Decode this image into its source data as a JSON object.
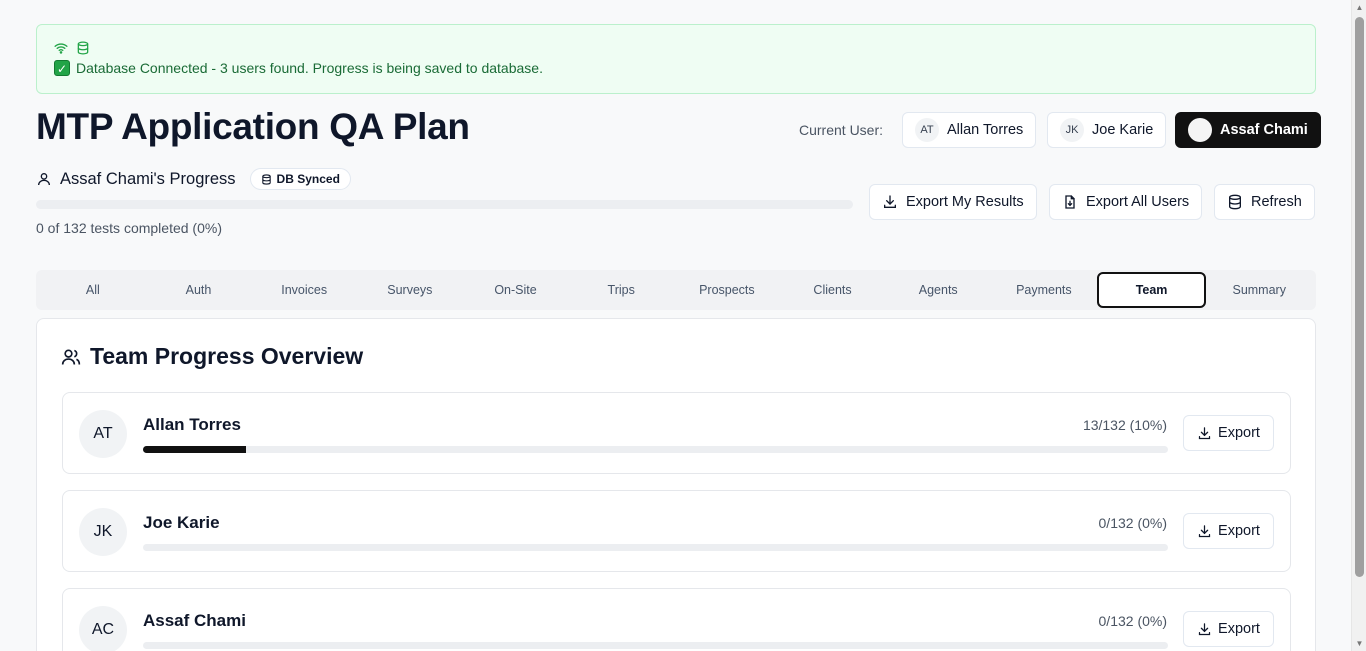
{
  "banner": {
    "message": "Database Connected - 3 users found. Progress is being saved to database.",
    "icons": [
      "wifi-icon",
      "database-icon",
      "checkmark-icon"
    ],
    "bg_color": "#effdf3",
    "text_color": "#1a6b36"
  },
  "header": {
    "title": "MTP Application QA Plan",
    "current_user_label": "Current User:",
    "users": [
      {
        "initials": "AT",
        "name": "Allan Torres",
        "active": false
      },
      {
        "initials": "JK",
        "name": "Joe Karie",
        "active": false
      },
      {
        "initials": "",
        "name": "Assaf Chami",
        "active": true
      }
    ]
  },
  "progress": {
    "label": "Assaf Chami's Progress",
    "badge": "DB Synced",
    "summary": "0 of 132 tests completed (0%)",
    "fraction": 0
  },
  "actions": {
    "export_mine": "Export My Results",
    "export_all": "Export All Users",
    "refresh": "Refresh"
  },
  "tabs": [
    {
      "label": "All",
      "active": false
    },
    {
      "label": "Auth",
      "active": false
    },
    {
      "label": "Invoices",
      "active": false
    },
    {
      "label": "Surveys",
      "active": false
    },
    {
      "label": "On-Site",
      "active": false
    },
    {
      "label": "Trips",
      "active": false
    },
    {
      "label": "Prospects",
      "active": false
    },
    {
      "label": "Clients",
      "active": false
    },
    {
      "label": "Agents",
      "active": false
    },
    {
      "label": "Payments",
      "active": false
    },
    {
      "label": "Team",
      "active": true
    },
    {
      "label": "Summary",
      "active": false
    }
  ],
  "team": {
    "title": "Team Progress Overview",
    "export_label": "Export",
    "members": [
      {
        "initials": "AT",
        "name": "Allan Torres",
        "count": "13/132 (10%)",
        "fraction": 0.1
      },
      {
        "initials": "JK",
        "name": "Joe Karie",
        "count": "0/132 (0%)",
        "fraction": 0
      },
      {
        "initials": "AC",
        "name": "Assaf Chami",
        "count": "0/132 (0%)",
        "fraction": 0
      }
    ]
  }
}
